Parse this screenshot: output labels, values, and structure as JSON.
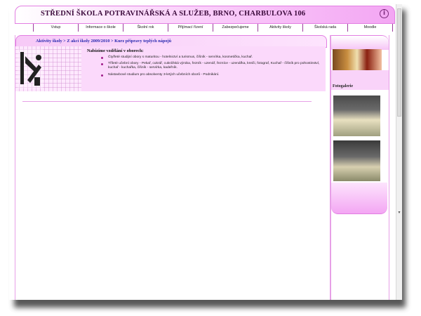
{
  "header": {
    "title": "STŘEDNÍ ŠKOLA POTRAVINÁŘSKÁ A SLUŽEB, BRNO, CHARBULOVA  106"
  },
  "nav": {
    "items": [
      "Vstup",
      "Informace o škole",
      "Školní rok",
      "Přijímací řízení",
      "Zabezpečujeme",
      "Aktivity školy",
      "Školská rada",
      "Moodle"
    ]
  },
  "breadcrumb": "Aktivity školy > Z akcí školy 2009/2010 > Kurz přípravy teplých nápojů",
  "offer": {
    "title": "Nabízíme vzdělání v oborech:",
    "items": [
      "Čtyřleté studijní obory s maturitou - hotelnictví a turismus, číšník - servírka, kosmetička, kuchař.",
      "Tříleté učební obory - Pekař, cukrář, cukrářská výroba, řezník - uzenář, řezníce - uzenářka, kreiči, fotograf, Kuchař - číšník pro pohostinství, kuchař - kuchařka, číšník - servírka, kadeřník.",
      "Nástavbové studium pro absolventy 3-letých učebních oborů - Podnikání."
    ]
  },
  "sidebar": {
    "gallery_label": "Fotogalerie"
  },
  "icons": {
    "info": "info-icon",
    "logo": "hands-logo-icon"
  },
  "colors": {
    "accent": "#f3a6f3",
    "border": "#e27ee2",
    "link": "#2a2ab0"
  }
}
